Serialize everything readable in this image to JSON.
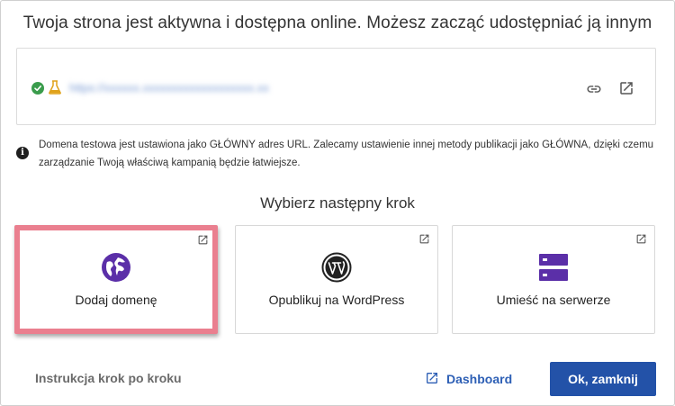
{
  "headline": "Twoja strona jest aktywna i dostępna online. Możesz zacząć udostępniać ją innym",
  "url_box": {
    "url": "https://xxxxxx.xxxxxxxxxxxxxxxxxxx.xx"
  },
  "info": {
    "text": "Domena testowa jest ustawiona jako GŁÓWNY adres URL. Zalecamy ustawienie innej metody publikacji jako GŁÓWNA, dzięki czemu zarządzanie Twoją właściwą kampanią będzie łatwiejsze."
  },
  "subhead": "Wybierz następny krok",
  "cards": [
    {
      "label": "Dodaj domenę"
    },
    {
      "label": "Opublikuj na WordPress"
    },
    {
      "label": "Umieść na serwerze"
    }
  ],
  "footer": {
    "instructions_label": "Instrukcja krok po kroku",
    "dashboard_label": "Dashboard",
    "ok_label": "Ok, zamknij"
  },
  "colors": {
    "primary": "#2352a8",
    "accent_purple": "#5b2fa8",
    "highlight": "#ea7f8f",
    "success": "#3a9c4c",
    "warning": "#e0a21a"
  }
}
